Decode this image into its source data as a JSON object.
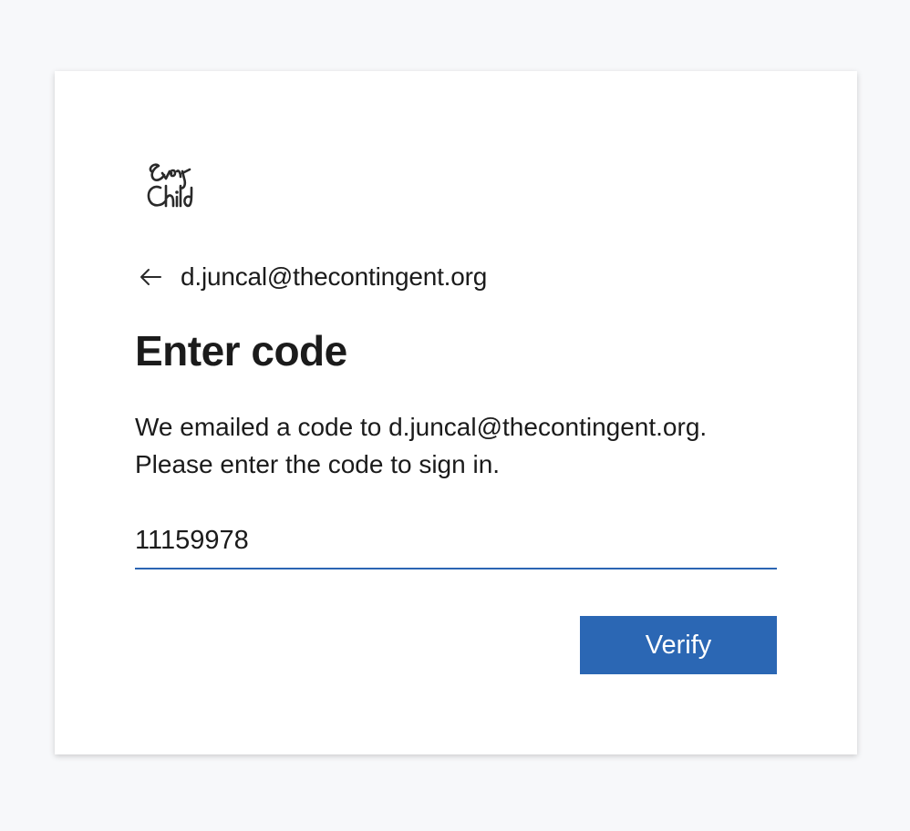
{
  "logo": {
    "name": "everychild-logo",
    "text_line1": "Every",
    "text_line2": "Child"
  },
  "identity": {
    "back_icon": "arrow-left-icon",
    "email": "d.juncal@thecontingent.org"
  },
  "heading": "Enter code",
  "description": {
    "line1": "We emailed a code to d.juncal@thecontingent.org.",
    "line2": "Please enter the code to sign in."
  },
  "code_input": {
    "value": "11159978",
    "placeholder": ""
  },
  "verify_button": {
    "label": "Verify"
  },
  "colors": {
    "background": "#f7f8fa",
    "accent": "#2b67b4",
    "text": "#1b1b1b"
  }
}
